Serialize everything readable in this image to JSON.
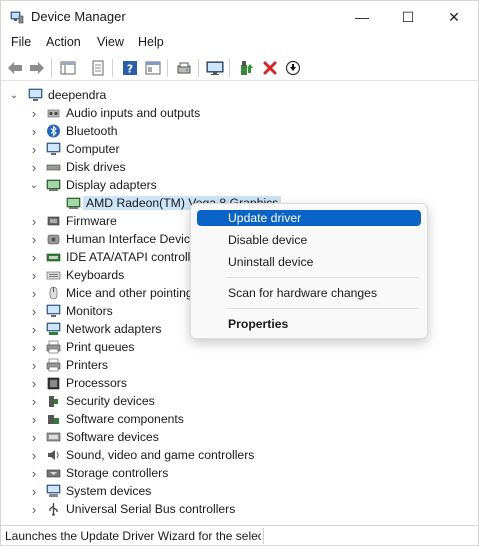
{
  "window": {
    "title": "Device Manager",
    "minimize_glyph": "—",
    "maximize_glyph": "☐",
    "close_glyph": "✕"
  },
  "menu": [
    "File",
    "Action",
    "View",
    "Help"
  ],
  "toolbar": {
    "icons": [
      "back-icon",
      "forward-icon",
      "properties-sheet-icon",
      "print-icon",
      "help-icon",
      "view-icon",
      "scan-hardware-icon",
      "monitor-icon",
      "update-driver-icon",
      "uninstall-icon",
      "disable-icon"
    ]
  },
  "tree": {
    "root": "deependra",
    "items": [
      {
        "label": "Audio inputs and outputs",
        "icon": "speaker-icon"
      },
      {
        "label": "Bluetooth",
        "icon": "bluetooth-icon"
      },
      {
        "label": "Computer",
        "icon": "computer-icon"
      },
      {
        "label": "Disk drives",
        "icon": "disk-drive-icon"
      },
      {
        "label": "Display adapters",
        "icon": "display-adapter-icon",
        "expanded": true
      },
      {
        "label": "AMD Radeon(TM) Vega 8 Graphics",
        "icon": "display-adapter-icon",
        "child": true,
        "selected": true
      },
      {
        "label": "Firmware",
        "icon": "firmware-icon"
      },
      {
        "label": "Human Interface Devices",
        "icon": "hid-icon"
      },
      {
        "label": "IDE ATA/ATAPI controllers",
        "icon": "ide-icon"
      },
      {
        "label": "Keyboards",
        "icon": "keyboard-icon"
      },
      {
        "label": "Mice and other pointing devices",
        "icon": "mouse-icon"
      },
      {
        "label": "Monitors",
        "icon": "monitor-icon"
      },
      {
        "label": "Network adapters",
        "icon": "network-adapter-icon"
      },
      {
        "label": "Print queues",
        "icon": "printer-icon"
      },
      {
        "label": "Printers",
        "icon": "printer-icon"
      },
      {
        "label": "Processors",
        "icon": "processor-icon"
      },
      {
        "label": "Security devices",
        "icon": "security-device-icon"
      },
      {
        "label": "Software components",
        "icon": "software-component-icon"
      },
      {
        "label": "Software devices",
        "icon": "software-device-icon"
      },
      {
        "label": "Sound, video and game controllers",
        "icon": "sound-icon"
      },
      {
        "label": "Storage controllers",
        "icon": "storage-controller-icon"
      },
      {
        "label": "System devices",
        "icon": "system-device-icon"
      },
      {
        "label": "Universal Serial Bus controllers",
        "icon": "usb-icon"
      }
    ]
  },
  "context_menu": {
    "update_driver": "Update driver",
    "disable_device": "Disable device",
    "uninstall_device": "Uninstall device",
    "scan": "Scan for hardware changes",
    "properties": "Properties"
  },
  "status": "Launches the Update Driver Wizard for the selected device.",
  "colors": {
    "accent": "#0a64c8",
    "selection": "#cce4f7",
    "error_red": "#e02020"
  }
}
